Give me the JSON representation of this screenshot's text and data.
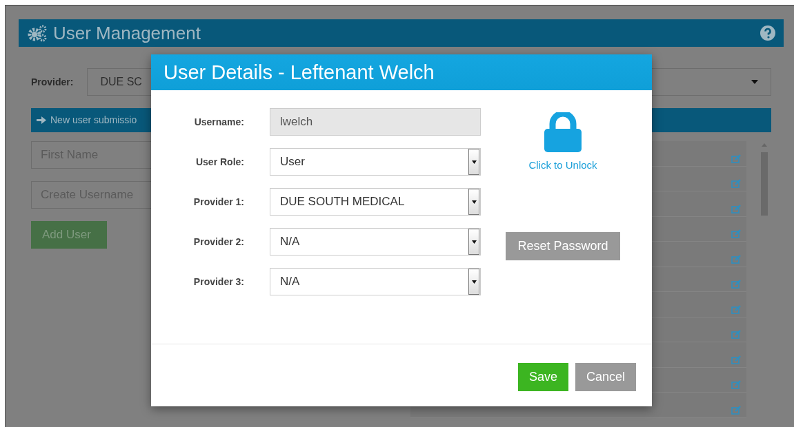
{
  "page": {
    "title": "User Management",
    "provider_label": "Provider:",
    "provider_value": "DUE SC",
    "new_user_bar": "New user submissio",
    "first_name": {
      "placeholder": "First Name"
    },
    "username": {
      "placeholder": "Create Username"
    },
    "add_button": {
      "label": "Add User",
      "disabled": true
    },
    "user_list": [
      {
        "kind": "covered"
      },
      {
        "kind": "covered"
      },
      {
        "kind": "covered"
      },
      {
        "kind": "covered"
      },
      {
        "kind": "covered"
      },
      {
        "kind": "covered"
      },
      {
        "kind": "covered"
      },
      {
        "kind": "covered"
      },
      {
        "kind": "covered"
      },
      {
        "kind": "covered"
      },
      {
        "kind": "covered"
      }
    ]
  },
  "modal": {
    "title": "User Details - Leftenant Welch",
    "fields": [
      {
        "label": "Username:",
        "value": "lwelch",
        "kind": "readonly"
      },
      {
        "label": "User Role:",
        "value": "User",
        "kind": "select"
      },
      {
        "label": "Provider 1:",
        "value": "DUE SOUTH MEDICAL",
        "kind": "select"
      },
      {
        "label": "Provider 2:",
        "value": "N/A",
        "kind": "select"
      },
      {
        "label": "Provider 3:",
        "value": "N/A",
        "kind": "select"
      }
    ],
    "lock": {
      "locked": true,
      "link": "Click to Unlock"
    },
    "reset_button": "Reset Password",
    "buttons": [
      {
        "label": "Save",
        "kind": "primary"
      },
      {
        "label": "Cancel",
        "kind": "secondary"
      }
    ]
  }
}
